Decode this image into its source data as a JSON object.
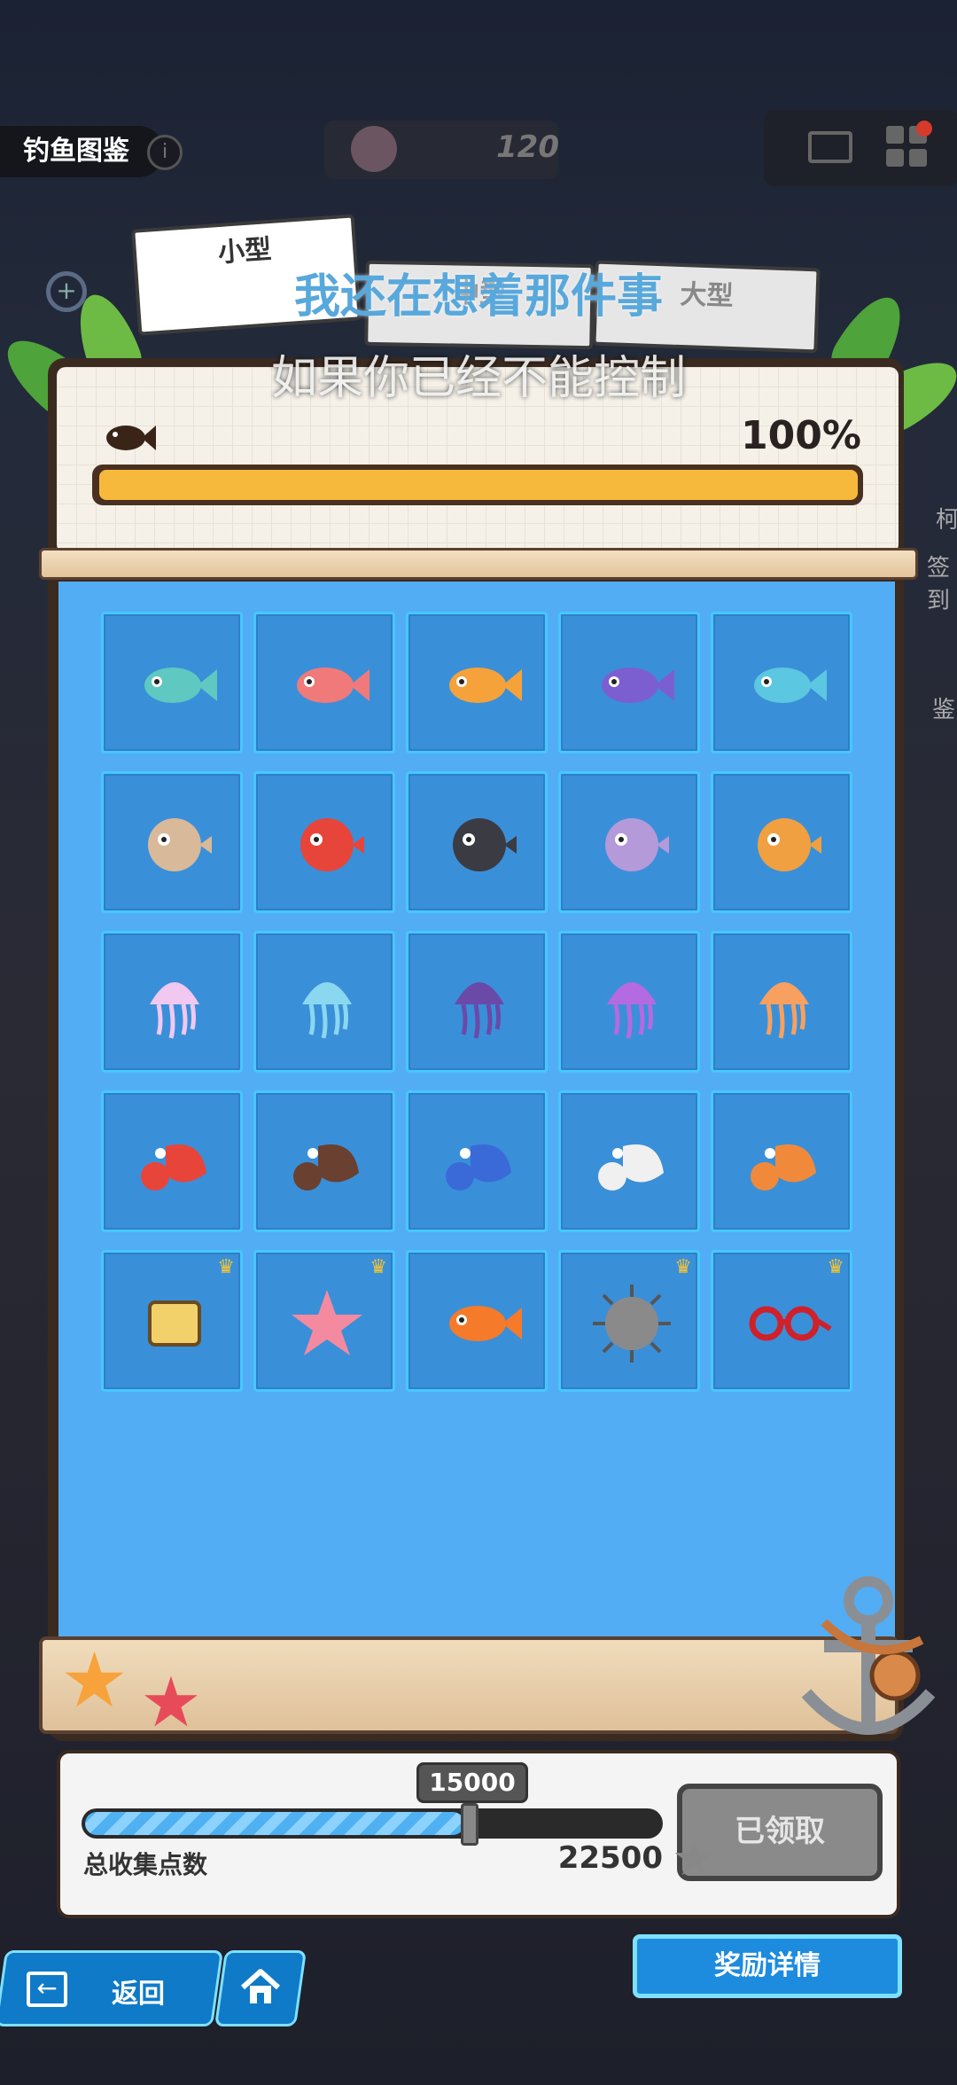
{
  "header": {
    "title": "钓鱼图鉴",
    "info_icon": "info-icon",
    "currency_value": "120"
  },
  "top_right": {
    "mail_icon": "mail-icon",
    "menu_icon": "menu-grid-icon"
  },
  "tabs": [
    {
      "label": "小型",
      "selected": true
    },
    {
      "label": "中型",
      "selected": false
    },
    {
      "label": "大型",
      "selected": false
    }
  ],
  "overlay_text": {
    "line1": "我还在想着那件事",
    "line2": "如果你已经不能控制"
  },
  "progress": {
    "percent_label": "100%",
    "fraction": 1.0
  },
  "collection": {
    "rows": [
      [
        {
          "name": "teal-fish",
          "crown": false
        },
        {
          "name": "pink-fish",
          "crown": false
        },
        {
          "name": "goldfish",
          "crown": false
        },
        {
          "name": "betta-fish",
          "crown": false
        },
        {
          "name": "yellow-tail-fish",
          "crown": false
        }
      ],
      [
        {
          "name": "pufferfish-spotted",
          "crown": false
        },
        {
          "name": "pufferfish-red",
          "crown": false
        },
        {
          "name": "pufferfish-dark",
          "crown": false
        },
        {
          "name": "pufferfish-purple",
          "crown": false
        },
        {
          "name": "pufferfish-orange",
          "crown": false
        }
      ],
      [
        {
          "name": "jellyfish-pink",
          "crown": false
        },
        {
          "name": "jellyfish-blue",
          "crown": false
        },
        {
          "name": "jellyfish-dark-purple",
          "crown": false
        },
        {
          "name": "jellyfish-violet",
          "crown": false
        },
        {
          "name": "jellyfish-orange",
          "crown": false
        }
      ],
      [
        {
          "name": "hermit-crab-red",
          "crown": false
        },
        {
          "name": "hermit-crab-brown",
          "crown": false
        },
        {
          "name": "hermit-crab-blue",
          "crown": false
        },
        {
          "name": "hermit-crab-white",
          "crown": false
        },
        {
          "name": "hermit-crab-orange",
          "crown": false
        }
      ],
      [
        {
          "name": "sponge",
          "crown": true
        },
        {
          "name": "starfish",
          "crown": true
        },
        {
          "name": "clownfish",
          "crown": false
        },
        {
          "name": "urchin-fish",
          "crown": true
        },
        {
          "name": "red-glasses",
          "crown": true
        }
      ]
    ],
    "crown_glyph": "♛"
  },
  "points": {
    "milestone": "15000",
    "label": "总收集点数",
    "total": "22500",
    "progress_fraction": 0.66,
    "claim_button": "已领取"
  },
  "nav": {
    "back_label": "返回",
    "home_icon": "home-icon",
    "reward_details": "奖励详情"
  },
  "side_text": {
    "right1": "柯",
    "right2": "签到",
    "right3": "鉴"
  },
  "colors": {
    "progress": "#f6b93b",
    "grid_bg": "#52adf4",
    "cell_bg": "#3a8fd9",
    "cell_border": "#47c7ff",
    "button_blue": "#1d8bde"
  }
}
